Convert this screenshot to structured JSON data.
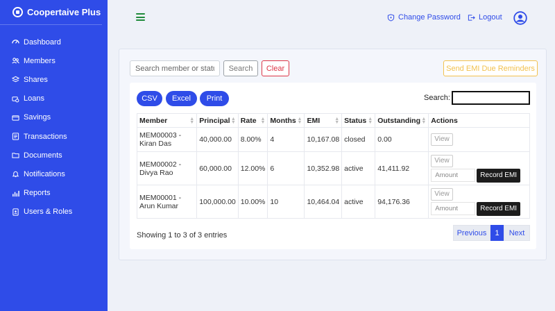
{
  "brand": {
    "name": "Coopertaive Plus"
  },
  "sidebar": {
    "items": [
      {
        "label": "Dashboard",
        "icon": "dashboard-icon"
      },
      {
        "label": "Members",
        "icon": "members-icon"
      },
      {
        "label": "Shares",
        "icon": "shares-icon"
      },
      {
        "label": "Loans",
        "icon": "loans-icon"
      },
      {
        "label": "Savings",
        "icon": "savings-icon"
      },
      {
        "label": "Transactions",
        "icon": "transactions-icon"
      },
      {
        "label": "Documents",
        "icon": "documents-icon"
      },
      {
        "label": "Notifications",
        "icon": "bell-icon"
      },
      {
        "label": "Reports",
        "icon": "reports-icon"
      },
      {
        "label": "Users & Roles",
        "icon": "users-roles-icon"
      }
    ]
  },
  "topbar": {
    "change_password": "Change Password",
    "logout": "Logout"
  },
  "filters": {
    "search_placeholder": "Search member or status",
    "search_label": "Search",
    "clear_label": "Clear",
    "reminder_label": "Send EMI Due Reminders"
  },
  "export": {
    "csv": "CSV",
    "excel": "Excel",
    "print": "Print",
    "search_label": "Search:"
  },
  "table": {
    "columns": [
      "Member",
      "Principal",
      "Rate",
      "Months",
      "EMI",
      "Status",
      "Outstanding",
      "Actions"
    ],
    "rows": [
      {
        "member": "MEM00003 - Kiran Das",
        "principal": "40,000.00",
        "rate": "8.00%",
        "months": "4",
        "emi": "10,167.08",
        "status": "closed",
        "outstanding": "0.00",
        "view": "View"
      },
      {
        "member": "MEM00002 - Divya Rao",
        "principal": "60,000.00",
        "rate": "12.00%",
        "months": "6",
        "emi": "10,352.98",
        "status": "active",
        "outstanding": "41,411.92",
        "view": "View",
        "amount_placeholder": "Amount",
        "record": "Record EMI"
      },
      {
        "member": "MEM00001 - Arun Kumar",
        "principal": "100,000.00",
        "rate": "10.00%",
        "months": "10",
        "emi": "10,464.04",
        "status": "active",
        "outstanding": "94,176.36",
        "view": "View",
        "amount_placeholder": "Amount",
        "record": "Record EMI"
      }
    ]
  },
  "footer": {
    "entries": "Showing 1 to 3 of 3 entries",
    "previous": "Previous",
    "page": "1",
    "next": "Next"
  },
  "colors": {
    "primary": "#2f4ce8",
    "danger": "#dc3545",
    "warning": "#f2c14e",
    "hamburger": "#1e8a3a"
  }
}
